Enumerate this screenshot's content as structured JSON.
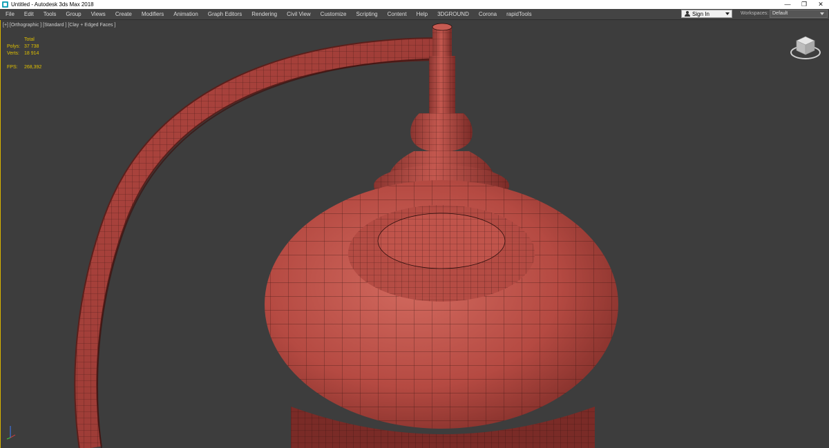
{
  "window": {
    "title": "Untitled - Autodesk 3ds Max 2018",
    "controls": {
      "minimize": "—",
      "restore": "❐",
      "close": "✕"
    }
  },
  "menu": {
    "items": [
      "File",
      "Edit",
      "Tools",
      "Group",
      "Views",
      "Create",
      "Modifiers",
      "Animation",
      "Graph Editors",
      "Rendering",
      "Civil View",
      "Customize",
      "Scripting",
      "Content",
      "Help",
      "3DGROUND",
      "Corona",
      "rapidTools"
    ]
  },
  "account": {
    "signin_label": "Sign In"
  },
  "workspaces": {
    "label": "Workspaces:",
    "value": "Default"
  },
  "viewport": {
    "label": "[+] [Orthographic ] [Standard ] [Clay + Edged Faces ]",
    "stats": {
      "header": "Total",
      "polys_label": "Polys:",
      "polys_value": "37 738",
      "verts_label": "Verts:",
      "verts_value": "18 914",
      "fps_label": "FPS:",
      "fps_value": "268,392"
    }
  },
  "colors": {
    "viewport_bg": "#3d3d3d",
    "model": "#b54a42",
    "model_dark": "#6e2521",
    "wire": "#2a0e0c",
    "stats_text": "#e0c000",
    "active_border": "#d8b400"
  },
  "icons": [
    "app-icon",
    "user-icon",
    "viewcube-icon",
    "axis-tripod-icon"
  ]
}
